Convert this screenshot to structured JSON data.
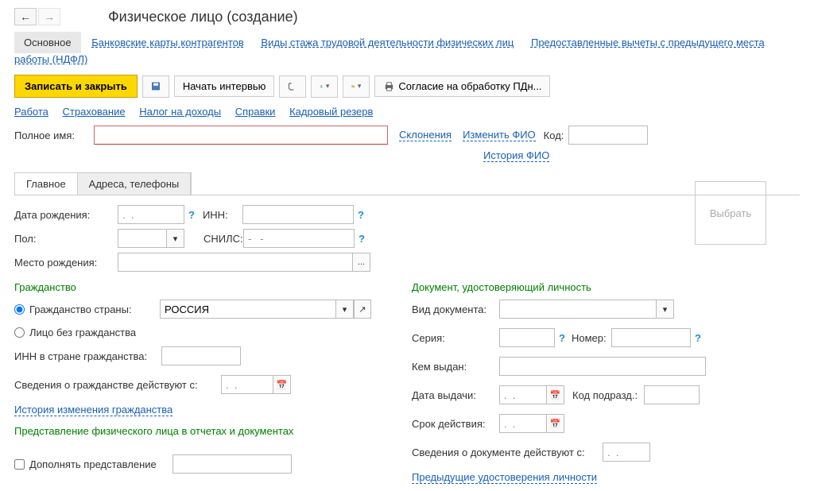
{
  "header": {
    "title": "Физическое лицо (создание)"
  },
  "topTabs": {
    "main": "Основное",
    "links": [
      "Банковские карты контрагентов",
      "Виды стажа трудовой деятельности физических лиц",
      "Предоставленные вычеты с предыдущего места работы (НДФЛ)"
    ]
  },
  "toolbar": {
    "saveClose": "Записать и закрыть",
    "startInterview": "Начать интервью",
    "consent": "Согласие на обработку ПДн..."
  },
  "secondary": [
    "Работа",
    "Страхование",
    "Налог на доходы",
    "Справки",
    "Кадровый резерв"
  ],
  "fullName": {
    "label": "Полное имя:",
    "value": "",
    "declensions": "Склонения",
    "changeFIO": "Изменить ФИО",
    "codeLabel": "Код:",
    "codeValue": "",
    "history": "История ФИО"
  },
  "tabs": [
    "Главное",
    "Адреса, телефоны"
  ],
  "main": {
    "dobLabel": "Дата рождения:",
    "dobValue": ".  .",
    "innLabel": "ИНН:",
    "innValue": "",
    "sexLabel": "Пол:",
    "sexValue": "",
    "snilsLabel": "СНИЛС:",
    "snilsValue": "-   -",
    "birthPlaceLabel": "Место рождения:",
    "birthPlaceValue": ""
  },
  "citizenship": {
    "section": "Гражданство",
    "countryLabel": "Гражданство страны:",
    "countryValue": "РОССИЯ",
    "noCitizenship": "Лицо без гражданства",
    "innCountryLabel": "ИНН в стране гражданства:",
    "innCountryValue": "",
    "validFromLabel": "Сведения о гражданстве действуют с:",
    "validFromValue": ".  .",
    "history": "История изменения гражданства",
    "representation": "Представление физического лица в отчетах и документах",
    "addRepresentation": "Дополнять представление",
    "addValue": ""
  },
  "identity": {
    "section": "Документ, удостоверяющий личность",
    "docTypeLabel": "Вид документа:",
    "docTypeValue": "",
    "seriesLabel": "Серия:",
    "seriesValue": "",
    "numberLabel": "Номер:",
    "numberValue": "",
    "issuedByLabel": "Кем выдан:",
    "issuedByValue": "",
    "issueDateLabel": "Дата выдачи:",
    "issueDateValue": ".  .",
    "deptCodeLabel": "Код подразд.:",
    "deptCodeValue": "",
    "validityLabel": "Срок действия:",
    "validityValue": ".  .",
    "docValidFromLabel": "Сведения о документе действуют с:",
    "docValidFromValue": ".  .",
    "prevDocs": "Предыдущие удостоверения личности"
  },
  "photoBtn": "Выбрать"
}
